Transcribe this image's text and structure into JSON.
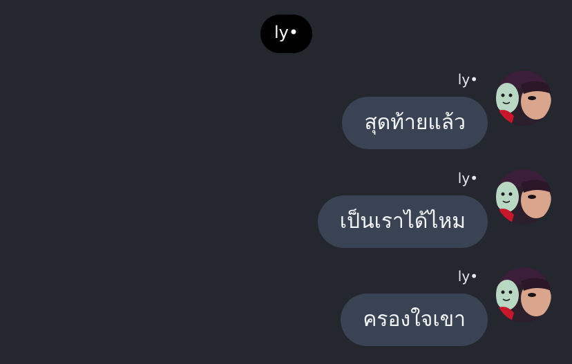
{
  "header": {
    "name": "ly•"
  },
  "messages": [
    {
      "sender": "ly•",
      "text": "สุดท้ายแล้ว",
      "avatar": "user-avatar"
    },
    {
      "sender": "ly•",
      "text": "เป็นเราได้ไหม",
      "avatar": "user-avatar"
    },
    {
      "sender": "ly•",
      "text": "ครองใจเขา",
      "avatar": "user-avatar"
    }
  ],
  "colors": {
    "background": "#24272e",
    "bubble": "#3a4353",
    "header_pill": "#000000",
    "text": "#f4f6f8"
  }
}
